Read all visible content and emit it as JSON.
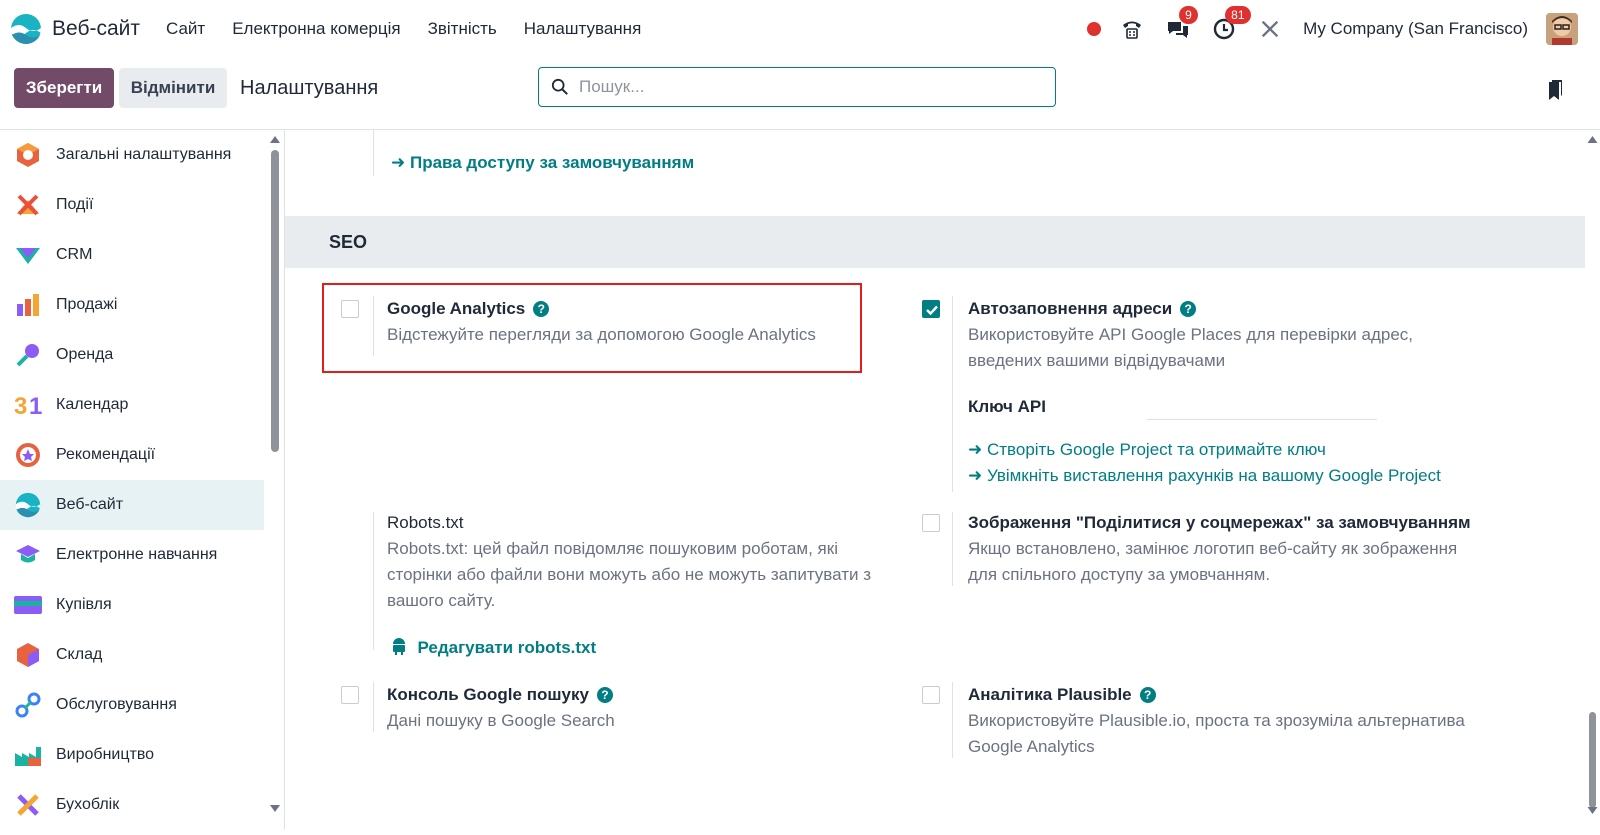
{
  "navbar": {
    "app_name": "Веб-сайт",
    "menu": [
      "Сайт",
      "Електронна комерція",
      "Звітність",
      "Налаштування"
    ],
    "messages_count": "9",
    "activities_count": "81",
    "company": "My Company (San Francisco)"
  },
  "control": {
    "save_label": "Зберегти",
    "cancel_label": "Відмінити",
    "title": "Налаштування",
    "search_placeholder": "Пошук..."
  },
  "sidebar": {
    "items": [
      {
        "label": "Загальні налаштування",
        "icon": "general-settings-icon"
      },
      {
        "label": "Події",
        "icon": "events-icon"
      },
      {
        "label": "CRM",
        "icon": "crm-icon"
      },
      {
        "label": "Продажі",
        "icon": "sales-icon"
      },
      {
        "label": "Оренда",
        "icon": "rental-icon"
      },
      {
        "label": "Календар",
        "icon": "calendar-icon"
      },
      {
        "label": "Рекомендації",
        "icon": "referrals-icon"
      },
      {
        "label": "Веб-сайт",
        "icon": "website-icon",
        "active": true
      },
      {
        "label": "Електронне навчання",
        "icon": "elearning-icon"
      },
      {
        "label": "Купівля",
        "icon": "purchase-icon"
      },
      {
        "label": "Склад",
        "icon": "inventory-icon"
      },
      {
        "label": "Обслуговування",
        "icon": "maintenance-icon"
      },
      {
        "label": "Виробництво",
        "icon": "manufacturing-icon"
      },
      {
        "label": "Бухоблік",
        "icon": "accounting-icon"
      }
    ]
  },
  "main": {
    "top_link": "Права доступу за замовчуванням",
    "section_title": "SEO",
    "settings": {
      "google_analytics": {
        "title": "Google Analytics",
        "desc": "Відстежуйте перегляди за допомогою Google Analytics",
        "checked": false
      },
      "autocomplete": {
        "title": "Автозаповнення адреси",
        "desc1": "Використовуйте API Google Places для перевірки адрес,",
        "desc2": "введених вашими відвідувачами",
        "checked": true,
        "api_key_label": "Ключ API",
        "link1": "Створіть Google Project та отримайте ключ",
        "link2": "Увімкніть виставлення рахунків на вашому Google Project"
      },
      "robots": {
        "title": "Robots.txt",
        "desc1": "Robots.txt: цей файл повідомляє пошуковим роботам, які",
        "desc2": "сторінки або файли вони можуть або не можуть запитувати з",
        "desc3": "вашого сайту.",
        "link": "Редагувати robots.txt"
      },
      "social_image": {
        "title": "Зображення \"Поділитися у соцмережах\" за замовчуванням",
        "desc1": "Якщо встановлено, замінює логотип веб-сайту як зображення",
        "desc2": "для спільного доступу за умовчанням.",
        "checked": false
      },
      "search_console": {
        "title": "Консоль Google пошуку",
        "desc": "Дані пошуку в Google Search",
        "checked": false
      },
      "plausible": {
        "title": "Аналітика Plausible",
        "desc1": "Використовуйте Plausible.io, проста та зрозуміла альтернатива",
        "desc2": "Google Analytics",
        "checked": false
      }
    }
  }
}
